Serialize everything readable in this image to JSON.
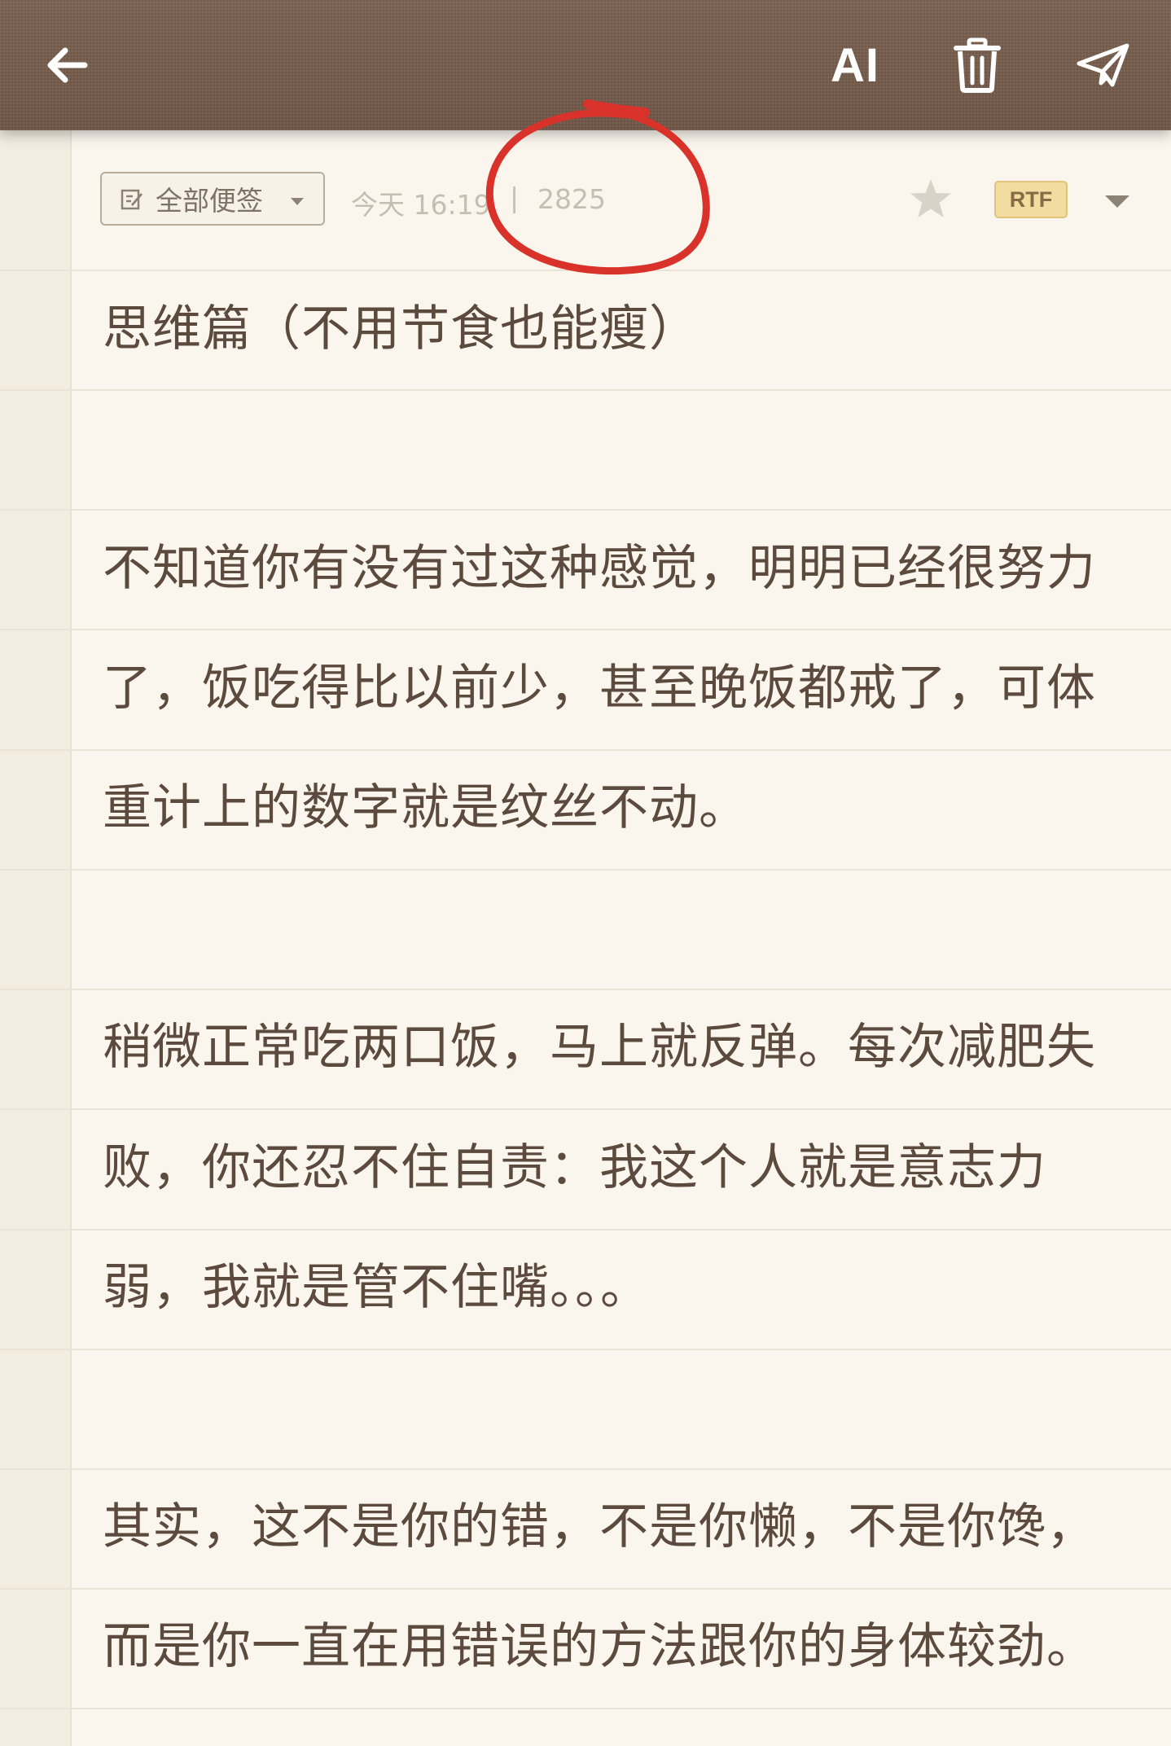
{
  "toolbar": {
    "back_icon": "arrow-left-icon",
    "ai_label": "AI",
    "trash_icon": "trash-icon",
    "send_icon": "paper-plane-icon"
  },
  "meta": {
    "folder_label": "全部便签",
    "timestamp": "今天 16:19",
    "separator": "|",
    "word_count": "2825",
    "format_badge": "RTF"
  },
  "note": {
    "title": "思维篇（不用节食也能瘦）",
    "lines": [
      "不知道你有没有过这种感觉，明明已经很努力",
      "了，饭吃得比以前少，甚至晚饭都戒了，可体",
      "重计上的数字就是纹丝不动。",
      "稍微正常吃两口饭，马上就反弹。每次减肥失",
      "败，你还忍不住自责：我这个人就是意志力",
      "弱，我就是管不住嘴。。。",
      "其实，这不是你的错，不是你懒，不是你馋，",
      "而是你一直在用错误的方法跟你的身体较劲。"
    ]
  },
  "colors": {
    "toolbar": "#745b4a",
    "paper": "#faf6ed",
    "text": "#5b4a3d",
    "annotation": "#d9322b",
    "rtf_badge": "#f3dca0"
  }
}
